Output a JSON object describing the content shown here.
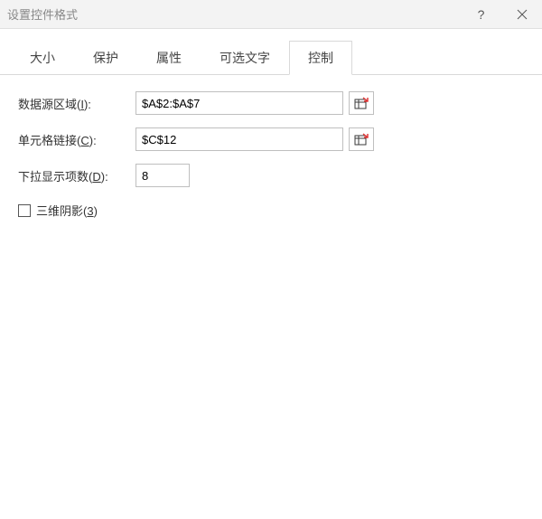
{
  "window": {
    "title": "设置控件格式"
  },
  "tabs": {
    "t0": "大小",
    "t1": "保护",
    "t2": "属性",
    "t3": "可选文字",
    "t4": "控制"
  },
  "form": {
    "source_label_pre": "数据源区域(",
    "source_label_u": "I",
    "source_label_post": "):",
    "source_value": "$A$2:$A$7",
    "link_label_pre": "单元格链接(",
    "link_label_u": "C",
    "link_label_post": "):",
    "link_value": "$C$12",
    "lines_label_pre": "下拉显示项数(",
    "lines_label_u": "D",
    "lines_label_post": "):",
    "lines_value": "8",
    "shadow_label_pre": "三维阴影(",
    "shadow_label_u": "3",
    "shadow_label_post": ")"
  }
}
